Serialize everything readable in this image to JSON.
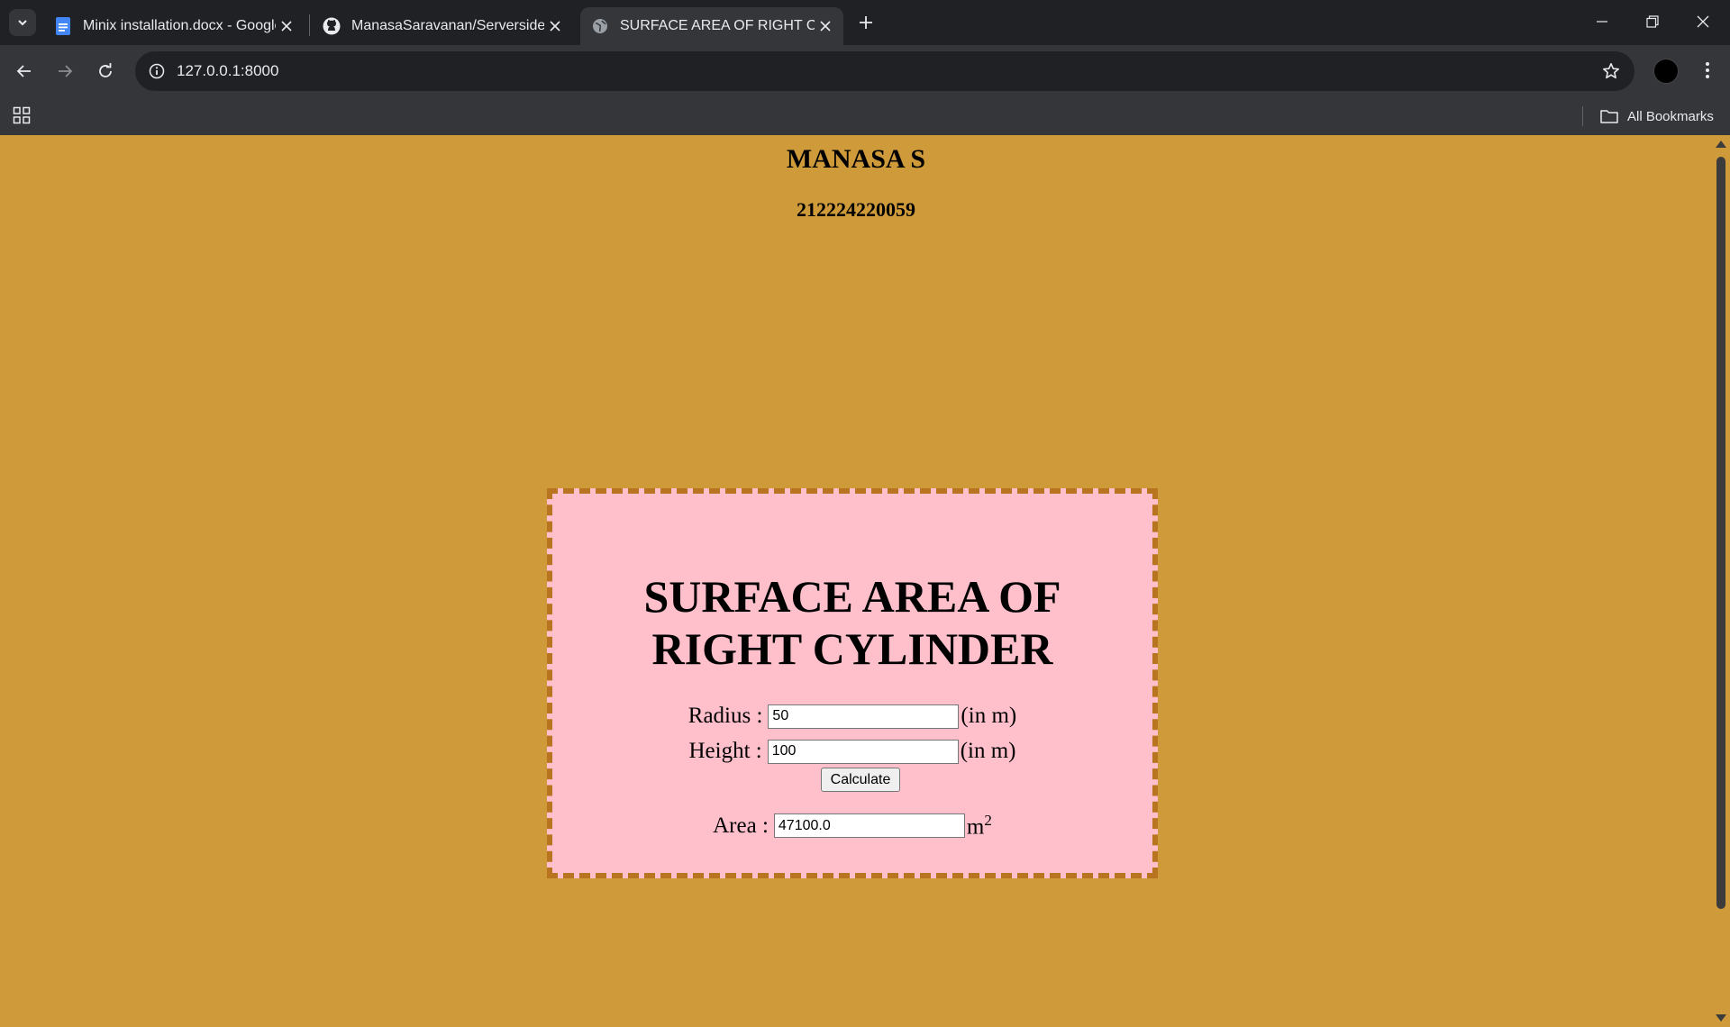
{
  "browser": {
    "tabs": [
      {
        "title": "Minix installation.docx - Google",
        "icon": "google-docs-icon",
        "active": false
      },
      {
        "title": "ManasaSaravanan/Serverside",
        "icon": "github-icon",
        "active": false
      },
      {
        "title": "SURFACE AREA OF RIGHT CYLIN",
        "icon": "globe-icon",
        "active": true
      }
    ],
    "url": "127.0.0.1:8000",
    "bookmarks_label": "All Bookmarks"
  },
  "page": {
    "name": "MANASA S",
    "reg_no": "212224220059",
    "heading_line1": "SURFACE AREA OF",
    "heading_line2": "RIGHT CYLINDER",
    "radius_label": "Radius :",
    "radius_value": "50",
    "radius_unit": "(in m)",
    "height_label": "Height :",
    "height_value": "100",
    "height_unit": "(in m)",
    "calculate_label": "Calculate",
    "area_label": "Area :",
    "area_value": "47100.0",
    "area_unit": "m",
    "area_unit_sup": "2"
  },
  "colors": {
    "page_bg": "#cf9a39",
    "card_bg": "#ffc0cb",
    "card_border": "#b8741f"
  }
}
